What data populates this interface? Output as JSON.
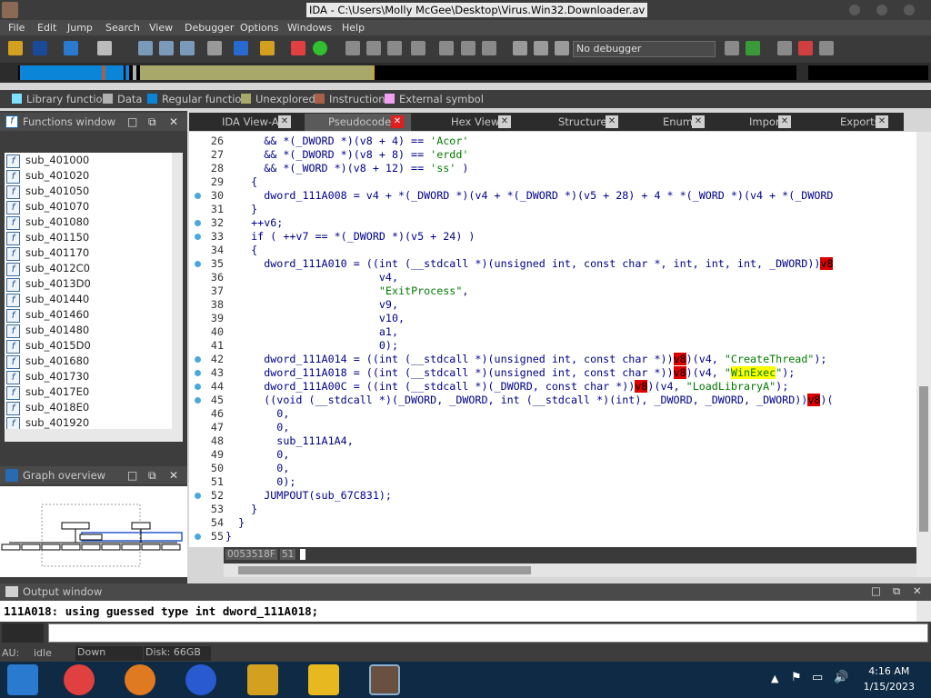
{
  "window": {
    "title": "IDA - C:\\Users\\Molly McGee\\Desktop\\Virus.Win32.Downloader.av"
  },
  "menu": [
    "File",
    "Edit",
    "Jump",
    "Search",
    "View",
    "Debugger",
    "Options",
    "Windows",
    "Help"
  ],
  "toolbar": {
    "debugger": "No debugger"
  },
  "legend": [
    {
      "label": "Library function",
      "color": "#7fe0ff"
    },
    {
      "label": "Data",
      "color": "#b0b0b0"
    },
    {
      "label": "Regular function",
      "color": "#0a85d8"
    },
    {
      "label": "Unexplored",
      "color": "#a8a86a"
    },
    {
      "label": "Instruction",
      "color": "#a86048"
    },
    {
      "label": "External symbol",
      "color": "#f2a0f2"
    }
  ],
  "functions_window": {
    "title": "Functions window",
    "items": [
      "sub_401000",
      "sub_401020",
      "sub_401050",
      "sub_401070",
      "sub_401080",
      "sub_401150",
      "sub_401170",
      "sub_4012C0",
      "sub_4013D0",
      "sub_401440",
      "sub_401460",
      "sub_401480",
      "sub_4015D0",
      "sub_401680",
      "sub_401730",
      "sub_4017E0",
      "sub_4018E0",
      "sub_401920"
    ]
  },
  "graph_overview": {
    "title": "Graph overview"
  },
  "tabs": [
    "IDA View-A",
    "Pseudocode-A",
    "Hex View-1",
    "Structures",
    "Enums",
    "Imports",
    "Exports"
  ],
  "code": {
    "line_numbers": [
      "26",
      "27",
      "28",
      "29",
      "30",
      "31",
      "32",
      "33",
      "34",
      "35",
      "36",
      "37",
      "38",
      "39",
      "40",
      "41",
      "42",
      "43",
      "44",
      "45",
      "46",
      "47",
      "48",
      "49",
      "50",
      "51",
      "52",
      "53",
      "54",
      "55"
    ],
    "lines": [
      "      && *(_DWORD *)(v8 + 4) == 'Acor'",
      "      && *(_DWORD *)(v8 + 8) == 'erdd'",
      "      && *(_WORD *)(v8 + 12) == 'ss' )",
      "    {",
      "      dword_111A008 = v4 + *(_DWORD *)(v4 + *(_DWORD *)(v5 + 28) + 4 * *(_WORD *)(v4 + *(_DWORD",
      "    }",
      "    ++v6;",
      "    if ( ++v7 == *(_DWORD *)(v5 + 24) )",
      "    {",
      "      dword_111A010 = ((int (__stdcall *)(unsigned int, const char *, int, int, int, _DWORD))v8",
      "                        v4,",
      "                        \"ExitProcess\",",
      "                        v9,",
      "                        v10,",
      "                        a1,",
      "                        0);",
      "      dword_111A014 = ((int (__stdcall *)(unsigned int, const char *))v8)(v4, \"CreateThread\");",
      "      dword_111A018 = ((int (__stdcall *)(unsigned int, const char *))v8)(v4, \"WinExec\");",
      "      dword_111A00C = ((int (__stdcall *)(_DWORD, const char *))v8)(v4, \"LoadLibraryA\");",
      "      ((void (__stdcall *)(_DWORD, _DWORD, int (__stdcall *)(int), _DWORD, _DWORD, _DWORD))v8)(",
      "        0,",
      "        0,",
      "        sub_111A1A4,",
      "        0,",
      "        0,",
      "        0);",
      "      JUMPOUT(sub_67C831);",
      "    }",
      "  }",
      "}"
    ],
    "address": "0053518F",
    "col": "51"
  },
  "output": {
    "title": "Output window",
    "text": "111A018: using guessed type int dword_111A018;"
  },
  "status": {
    "au": "AU:",
    "state": "idle",
    "direction": "Down",
    "disk": "Disk: 66GB"
  },
  "clock": {
    "time": "4:16 AM",
    "date": "1/15/2023"
  }
}
